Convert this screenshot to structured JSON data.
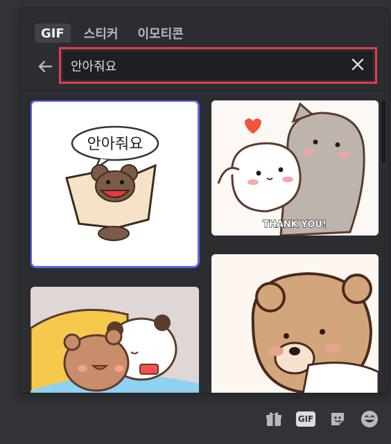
{
  "tabs": [
    {
      "label": "GIF",
      "active": true
    },
    {
      "label": "스티커",
      "active": false
    },
    {
      "label": "이모티콘",
      "active": false
    }
  ],
  "search": {
    "value": "안아줘요",
    "back_icon": "arrow-left-icon",
    "clear_icon": "close-icon"
  },
  "results": [
    {
      "speech_text": "안아줘요",
      "selected": true
    },
    {
      "caption": "THANK YOU!",
      "selected": false
    },
    {
      "selected": false
    },
    {
      "selected": false
    }
  ],
  "bottom_bar": {
    "gift_icon": "gift-icon",
    "gif_label": "GIF",
    "sticker_icon": "sticker-icon",
    "emoji_icon": "emoji-icon"
  },
  "colors": {
    "accent": "#5865f2",
    "highlight": "#e23f46"
  }
}
